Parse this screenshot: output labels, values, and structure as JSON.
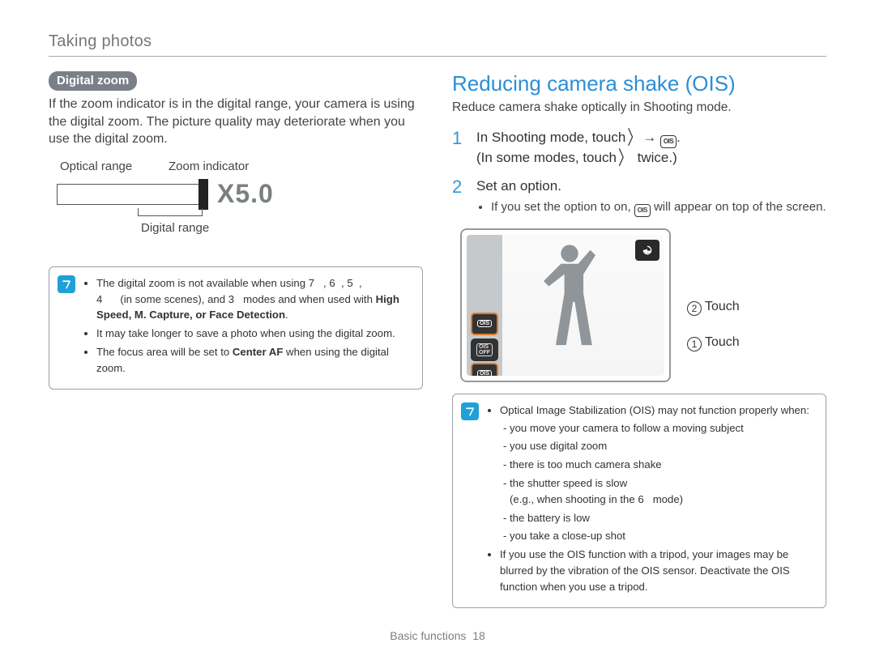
{
  "header": "Taking photos",
  "left": {
    "pill": "Digital zoom",
    "intro": "If the zoom indicator is in the digital range, your camera is using the digital zoom. The picture quality may deteriorate when you use the digital zoom.",
    "labels": {
      "optical": "Optical range",
      "indicator": "Zoom indicator",
      "digital": "Digital range",
      "x5": "X5.0"
    },
    "note1a": "The digital zoom is not available when using ",
    "note1b": " (in some scenes), and ",
    "note1c": " modes and when used with ",
    "note1strong": "High Speed, M. Capture, or Face Detection",
    "note2": "It may take longer to save a photo when using the digital zoom.",
    "note3a": "The focus area will be set to ",
    "note3strong": "Center AF",
    "note3b": " when using the digital zoom.",
    "g7": "7",
    "g6": "6",
    "g5": "5",
    "g4": "4",
    "g3": "3"
  },
  "right": {
    "title": "Reducing camera shake (OIS)",
    "intro": "Reduce camera shake optically in Shooting mode.",
    "step1a": "In Shooting mode, touch",
    "step1b": ".",
    "step1c": "(In some modes, touch",
    "step1d": " twice.)",
    "step2": "Set an option.",
    "step2sub_a": "If you set the option to on, ",
    "step2sub_b": " will appear on top of the screen.",
    "touch2": "Touch",
    "touch1": "Touch",
    "note_header": "Optical Image Stabilization (OIS) may not function properly when:",
    "note_list": {
      "a": "you move your camera to follow a moving subject",
      "b": "you use digital zoom",
      "c": "there is too much camera shake",
      "d": "the shutter speed is slow",
      "d2a": "(e.g., when shooting in the ",
      "d2b": " mode)",
      "g6": "6",
      "e": "the battery is low",
      "f": "you take a close-up shot"
    },
    "note_tripod": "If you use the OIS function with a tripod, your images may be blurred by the vibration of the OIS sensor. Deactivate the OIS function when you use a tripod.",
    "n1": "1",
    "n2": "2",
    "c1": "1",
    "c2": "2"
  },
  "footer": {
    "section": "Basic functions",
    "page": "18"
  }
}
